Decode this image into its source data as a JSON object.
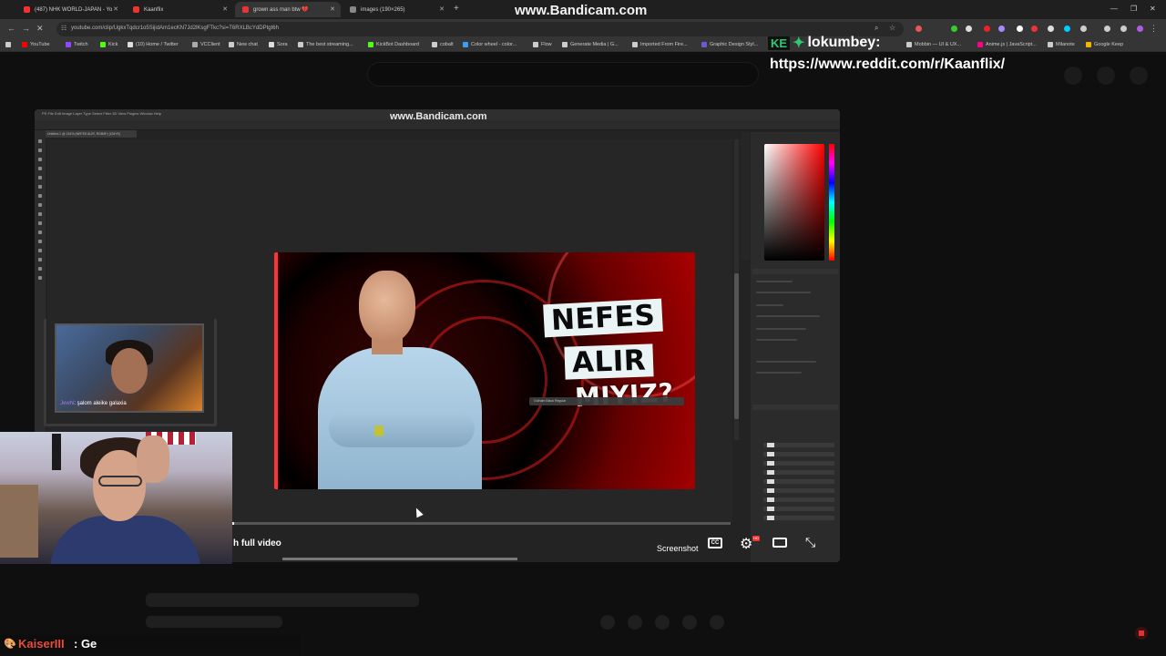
{
  "browser": {
    "tabs": [
      {
        "title": "(487) NHK WORLD-JAPAN - Yo",
        "color": "#ff2d2d",
        "active": false
      },
      {
        "title": "Kaanflix",
        "color": "#e33",
        "active": false
      },
      {
        "title": "grown ass man btw 💔",
        "color": "#e33",
        "active": true
      },
      {
        "title": "images (190×265)",
        "color": "#888",
        "active": false
      }
    ],
    "new_tab": "+",
    "url": "youtube.com/clip/UgkxTqdcr1o5SijidAm1ecKN7Jd2lKsgFTkc?si=T6RXLBcYdDPtgt6h",
    "bookmarks": [
      {
        "label": "YouTube",
        "color": "#ff0000"
      },
      {
        "label": "Twitch",
        "color": "#9146ff"
      },
      {
        "label": "Kick",
        "color": "#53fc18"
      },
      {
        "label": "(10) Home / Twitter",
        "color": "#ddd"
      },
      {
        "label": "VCClient",
        "color": "#aaa"
      },
      {
        "label": "New chat",
        "color": "#ccc"
      },
      {
        "label": "Sora",
        "color": "#ddd"
      },
      {
        "label": "The best streaming...",
        "color": "#ccc"
      },
      {
        "label": "KickBot Dashboard",
        "color": "#53fc18"
      },
      {
        "label": "cobalt",
        "color": "#ccc"
      },
      {
        "label": "Color wheel - color...",
        "color": "#3a9cf3"
      },
      {
        "label": "Flow",
        "color": "#ccc"
      },
      {
        "label": "Generate Media | G...",
        "color": "#ccc"
      },
      {
        "label": "Imported From Fire...",
        "color": "#ccc"
      },
      {
        "label": "Graphic Design Styl...",
        "color": "#6a5acd"
      },
      {
        "label": "Mobbin — UI & UX...",
        "color": "#ccc"
      },
      {
        "label": "Anime.js | JavaScript...",
        "color": "#f08"
      },
      {
        "label": "Milanote",
        "color": "#ccc"
      },
      {
        "label": "Google Keep",
        "color": "#f5b400"
      }
    ]
  },
  "watermark": "www.Bandicam.com",
  "overlay": {
    "logo_text": "KE",
    "handle": "lokumbey:",
    "reddit": "https://www.reddit.com/r/Kaanflix/"
  },
  "photoshop": {
    "menu": "PS  File  Edit  Image  Layer  Type  Select  Filter  3D  View  Plugins  Window  Help",
    "doc_tab": "Untitled-1 @ 134% (NEFES ALIR, RGB/8*) (CMYK)",
    "thumbnail": {
      "line1": "NEFES",
      "line2": "ALIR",
      "line3": "MIYIZ?"
    },
    "text_toolbar": "Gotham Black  Regular"
  },
  "webcam_chat": {
    "user": "Jewhi",
    "message": ": şalom aleike galaxia"
  },
  "player": {
    "watch_full": "h full video",
    "screenshot": "Screenshot",
    "cc": "CC",
    "settings_badge": "HD",
    "progress": 0.0
  },
  "ticker": {
    "user": "KaiserIII",
    "message": ": Ge"
  }
}
